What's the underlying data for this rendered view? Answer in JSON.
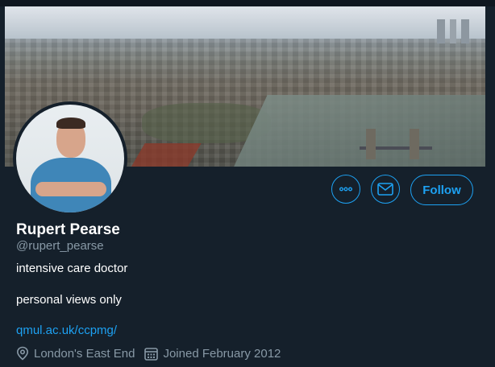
{
  "profile": {
    "name": "Rupert Pearse",
    "handle": "@rupert_pearse",
    "bio_line1": "intensive care doctor",
    "bio_line2": "personal views only",
    "website": "qmul.ac.uk/ccpmg/",
    "location": "London's East End",
    "joined": "Joined February 2012"
  },
  "actions": {
    "follow_label": "Follow",
    "more_icon": "more-horizontal-icon",
    "message_icon": "envelope-icon"
  },
  "colors": {
    "background": "#15202b",
    "accent": "#1da1f2",
    "secondary_text": "#8899a6"
  }
}
